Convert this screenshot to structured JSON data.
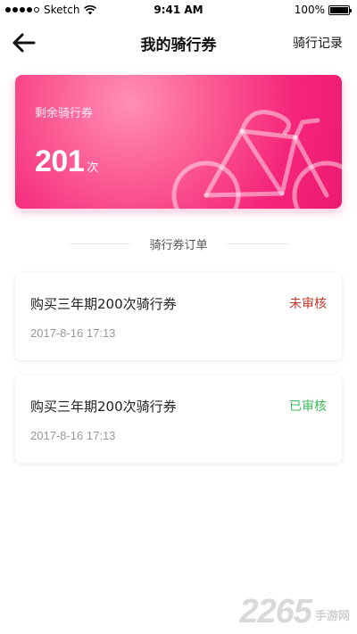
{
  "status_bar": {
    "carrier": "Sketch",
    "time": "9:41 AM",
    "battery": "100%"
  },
  "nav": {
    "title": "我的骑行券",
    "right_action": "骑行记录"
  },
  "balance_card": {
    "label": "剩余骑行券",
    "count": "201",
    "unit": "次"
  },
  "orders_section": {
    "title": "骑行券订单",
    "orders": [
      {
        "title": "购买三年期200次骑行券",
        "date": "2017-8-16 17:13",
        "status": "未审核",
        "status_color": "#c0392b"
      },
      {
        "title": "购买三年期200次骑行券",
        "date": "2017-8-16 17:13",
        "status": "已审核",
        "status_color": "#3bbd5a"
      }
    ]
  },
  "watermark": {
    "number": "2265",
    "site": "手游网"
  },
  "colors": {
    "card_gradient": [
      "#ff8fb5",
      "#ec1a70"
    ],
    "pending": "#c0392b",
    "approved": "#3bbd5a"
  }
}
